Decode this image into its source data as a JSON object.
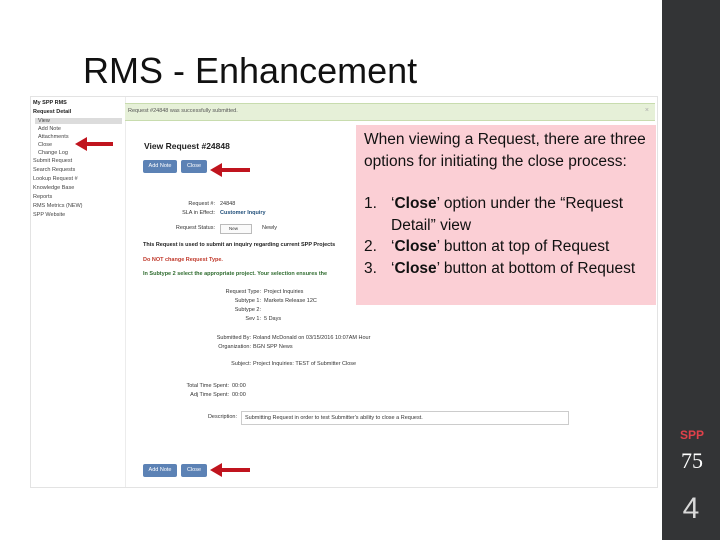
{
  "slide": {
    "title": "RMS - Enhancement",
    "page_number": "4",
    "logo": {
      "brand": "SPP",
      "years": "75"
    }
  },
  "sidebar": {
    "items": [
      "My SPP RMS",
      "Request Detail",
      "View",
      "Add Note",
      "Attachments",
      "Close",
      "Change Log",
      "Submit Request",
      "Search Requests",
      "Lookup Request #",
      "Knowledge Base",
      "Reports",
      "RMS Metrics (NEW)",
      "SPP Website"
    ]
  },
  "banner": {
    "message": "Request #24848 was successfully submitted.",
    "close": "×"
  },
  "request": {
    "title": "View Request #24848",
    "add_note_button": "Add Note",
    "close_button": "Close",
    "request_number_label": "Request #:",
    "request_number_value": "24848",
    "sla_label": "SLA in Effect:",
    "sla_value": "Customer Inquiry",
    "status_label": "Request Status:",
    "status_value": "New",
    "status_note": "Newly",
    "inquiry_line": "This Request is used to submit an inquiry regarding current SPP Projects",
    "do_not_change": "Do NOT change Request Type.",
    "subtype_instruction": "In Subtype 2 select the appropriate project. Your selection ensures the",
    "request_type_label": "Request Type:",
    "request_type_value": "Project Inquiries",
    "subtype1_label": "Subtype 1:",
    "subtype1_value": "Markets Release 12C",
    "subtype2_label": "Subtype 2:",
    "subtype2_value": "",
    "sev_label": "Sev 1:",
    "sev_value": "5 Days",
    "submitted_by_label": "Submitted By:",
    "submitted_by_value": "Roland McDonald on 03/15/2016 10:07AM Hour",
    "organization_label": "Organization:",
    "organization_value": "BGN SPP News",
    "subject_label": "Subject:",
    "subject_value": "Project Inquiries: TEST of Submitter Close",
    "total_time_label": "Total Time Spent:",
    "total_time_value": "00:00",
    "adj_time_label": "Adj Time Spent:",
    "adj_time_value": "00:00",
    "description_label": "Description:",
    "description_value": "Submitting Request in order to test Submitter's ability to close a Request."
  },
  "callout": {
    "intro": "When viewing a Request, there are three options for initiating the close process:",
    "options": [
      {
        "num": "1.",
        "emph": "Close",
        "pre": "‘",
        "post": "’ option under the “Request Detail” view"
      },
      {
        "num": "2.",
        "emph": "Close",
        "pre": "‘",
        "post": "’ button at top of Request"
      },
      {
        "num": "3.",
        "emph": "Close",
        "pre": "‘",
        "post": "’ button at bottom of Request"
      }
    ]
  },
  "colors": {
    "callout_bg": "#fbcfd5",
    "button_blue": "#5c82b5",
    "arrow_red": "#c0141e",
    "band": "#333436"
  }
}
